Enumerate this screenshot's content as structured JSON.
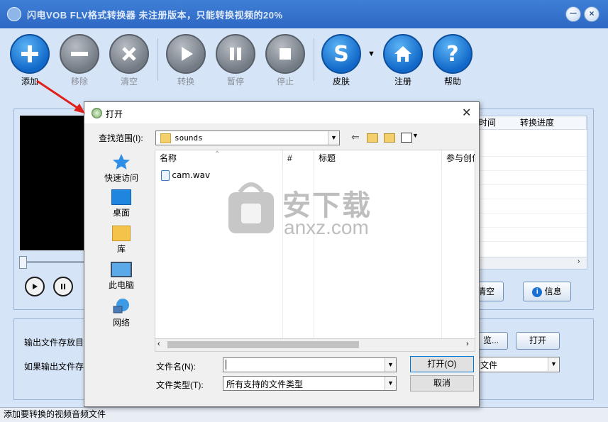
{
  "app": {
    "title": "闪电VOB FLV格式转换器  未注册版本，只能转换视频的20%",
    "window_controls": {
      "minimize": "－",
      "close": "×"
    }
  },
  "toolbar": {
    "items": [
      {
        "label": "添加",
        "icon": "plus-icon",
        "enabled": true
      },
      {
        "label": "移除",
        "icon": "minus-icon",
        "enabled": false
      },
      {
        "label": "清空",
        "icon": "x-icon",
        "enabled": false
      },
      {
        "label": "转换",
        "icon": "play-icon",
        "enabled": false
      },
      {
        "label": "暂停",
        "icon": "pause-icon",
        "enabled": false
      },
      {
        "label": "停止",
        "icon": "stop-icon",
        "enabled": false
      },
      {
        "label": "皮肤",
        "icon": "skin-s-icon",
        "enabled": true
      },
      {
        "label": "注册",
        "icon": "home-icon",
        "enabled": true
      },
      {
        "label": "帮助",
        "icon": "question-icon",
        "enabled": true
      }
    ],
    "skin_dropdown": "▼"
  },
  "file_list": {
    "columns": [
      "时间",
      "转换进度"
    ]
  },
  "list_buttons": {
    "clear": "清空",
    "info": "信息"
  },
  "output": {
    "dir_label": "输出文件存放目",
    "exists_label": "如果输出文件存",
    "browse_button": "览...",
    "open_button": "打开",
    "exists_value": "文件"
  },
  "status_bar": "添加要转换的视频音频文件",
  "dialog": {
    "title": "打开",
    "look_in_label": "查找范围(I):",
    "look_in_value": "sounds",
    "places": [
      "快速访问",
      "桌面",
      "库",
      "此电脑",
      "网络"
    ],
    "columns": [
      "名称",
      "#",
      "标题",
      "参与创作"
    ],
    "files": [
      {
        "name": "cam.wav"
      }
    ],
    "filename_label": "文件名(N):",
    "filename_value": "",
    "filetype_label": "文件类型(T):",
    "filetype_value": "所有支持的文件类型",
    "open_button": "打开(O)",
    "cancel_button": "取消"
  },
  "watermark": {
    "brand": "安下载",
    "domain": "anxz.com"
  },
  "colors": {
    "accent": "#2d68c4",
    "annotation_arrow": "#e0211b"
  }
}
